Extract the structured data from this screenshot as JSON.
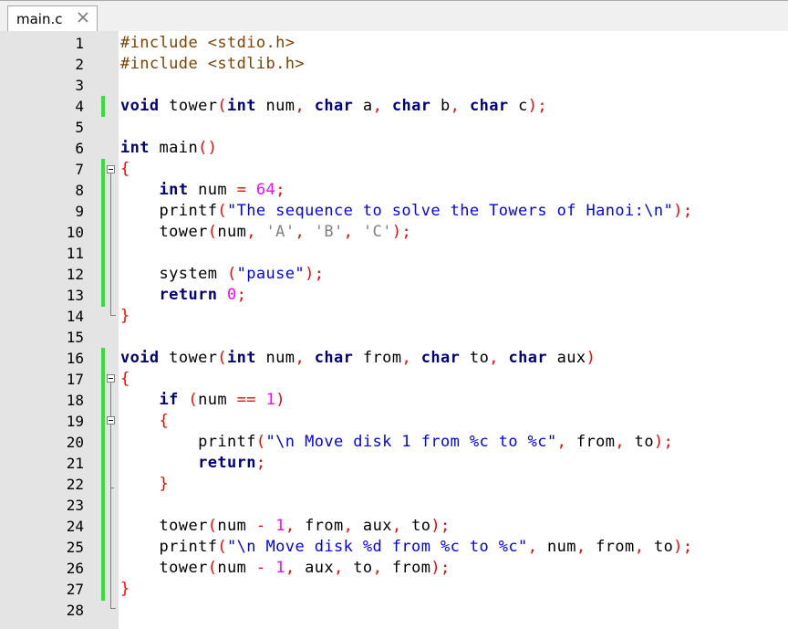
{
  "tab": {
    "filename": "main.c",
    "close_icon": "close-icon"
  },
  "colors": {
    "keyword": "#000080",
    "preprocessor": "#804000",
    "string_double": "#0000ff",
    "char_literal": "#808080",
    "number": "#ff00ff",
    "operator": "#ff0000",
    "changed_marker": "#2ee62e",
    "gutter_bg": "#e4e4e4"
  },
  "lines": [
    {
      "n": "1",
      "tokens": [
        {
          "t": "pp",
          "v": "#include <stdio.h>"
        }
      ]
    },
    {
      "n": "2",
      "tokens": [
        {
          "t": "pp",
          "v": "#include <stdlib.h>"
        }
      ]
    },
    {
      "n": "3",
      "tokens": []
    },
    {
      "n": "4",
      "tokens": [
        {
          "t": "kw",
          "v": "void"
        },
        {
          "t": "",
          "v": " tower"
        },
        {
          "t": "op",
          "v": "("
        },
        {
          "t": "kw",
          "v": "int"
        },
        {
          "t": "",
          "v": " num"
        },
        {
          "t": "op",
          "v": ","
        },
        {
          "t": "",
          "v": " "
        },
        {
          "t": "kw",
          "v": "char"
        },
        {
          "t": "",
          "v": " a"
        },
        {
          "t": "op",
          "v": ","
        },
        {
          "t": "",
          "v": " "
        },
        {
          "t": "kw",
          "v": "char"
        },
        {
          "t": "",
          "v": " b"
        },
        {
          "t": "op",
          "v": ","
        },
        {
          "t": "",
          "v": " "
        },
        {
          "t": "kw",
          "v": "char"
        },
        {
          "t": "",
          "v": " c"
        },
        {
          "t": "op",
          "v": ");"
        }
      ]
    },
    {
      "n": "5",
      "tokens": []
    },
    {
      "n": "6",
      "tokens": [
        {
          "t": "kw",
          "v": "int"
        },
        {
          "t": "",
          "v": " main"
        },
        {
          "t": "op",
          "v": "()"
        }
      ]
    },
    {
      "n": "7",
      "tokens": [
        {
          "t": "op",
          "v": "{"
        }
      ]
    },
    {
      "n": "8",
      "tokens": [
        {
          "t": "",
          "v": "    "
        },
        {
          "t": "kw",
          "v": "int"
        },
        {
          "t": "",
          "v": " num "
        },
        {
          "t": "op",
          "v": "="
        },
        {
          "t": "",
          "v": " "
        },
        {
          "t": "num",
          "v": "64"
        },
        {
          "t": "op",
          "v": ";"
        }
      ]
    },
    {
      "n": "9",
      "tokens": [
        {
          "t": "",
          "v": "    printf"
        },
        {
          "t": "op",
          "v": "("
        },
        {
          "t": "dq",
          "v": "\"The sequence to solve the Towers of Hanoi:\\n\""
        },
        {
          "t": "op",
          "v": ");"
        }
      ]
    },
    {
      "n": "10",
      "tokens": [
        {
          "t": "",
          "v": "    tower"
        },
        {
          "t": "op",
          "v": "("
        },
        {
          "t": "",
          "v": "num"
        },
        {
          "t": "op",
          "v": ","
        },
        {
          "t": "",
          "v": " "
        },
        {
          "t": "str",
          "v": "'A'"
        },
        {
          "t": "op",
          "v": ","
        },
        {
          "t": "",
          "v": " "
        },
        {
          "t": "str",
          "v": "'B'"
        },
        {
          "t": "op",
          "v": ","
        },
        {
          "t": "",
          "v": " "
        },
        {
          "t": "str",
          "v": "'C'"
        },
        {
          "t": "op",
          "v": ");"
        }
      ]
    },
    {
      "n": "11",
      "tokens": []
    },
    {
      "n": "12",
      "tokens": [
        {
          "t": "",
          "v": "    system "
        },
        {
          "t": "op",
          "v": "("
        },
        {
          "t": "dq",
          "v": "\"pause\""
        },
        {
          "t": "op",
          "v": ");"
        }
      ]
    },
    {
      "n": "13",
      "tokens": [
        {
          "t": "",
          "v": "    "
        },
        {
          "t": "kw",
          "v": "return"
        },
        {
          "t": "",
          "v": " "
        },
        {
          "t": "num",
          "v": "0"
        },
        {
          "t": "op",
          "v": ";"
        }
      ]
    },
    {
      "n": "14",
      "tokens": [
        {
          "t": "op",
          "v": "}"
        }
      ]
    },
    {
      "n": "15",
      "tokens": []
    },
    {
      "n": "16",
      "tokens": [
        {
          "t": "kw",
          "v": "void"
        },
        {
          "t": "",
          "v": " tower"
        },
        {
          "t": "op",
          "v": "("
        },
        {
          "t": "kw",
          "v": "int"
        },
        {
          "t": "",
          "v": " num"
        },
        {
          "t": "op",
          "v": ","
        },
        {
          "t": "",
          "v": " "
        },
        {
          "t": "kw",
          "v": "char"
        },
        {
          "t": "",
          "v": " from"
        },
        {
          "t": "op",
          "v": ","
        },
        {
          "t": "",
          "v": " "
        },
        {
          "t": "kw",
          "v": "char"
        },
        {
          "t": "",
          "v": " to"
        },
        {
          "t": "op",
          "v": ","
        },
        {
          "t": "",
          "v": " "
        },
        {
          "t": "kw",
          "v": "char"
        },
        {
          "t": "",
          "v": " aux"
        },
        {
          "t": "op",
          "v": ")"
        }
      ]
    },
    {
      "n": "17",
      "tokens": [
        {
          "t": "op",
          "v": "{"
        }
      ]
    },
    {
      "n": "18",
      "tokens": [
        {
          "t": "",
          "v": "    "
        },
        {
          "t": "kw",
          "v": "if"
        },
        {
          "t": "",
          "v": " "
        },
        {
          "t": "op",
          "v": "("
        },
        {
          "t": "",
          "v": "num "
        },
        {
          "t": "op",
          "v": "=="
        },
        {
          "t": "",
          "v": " "
        },
        {
          "t": "num",
          "v": "1"
        },
        {
          "t": "op",
          "v": ")"
        }
      ]
    },
    {
      "n": "19",
      "tokens": [
        {
          "t": "",
          "v": "    "
        },
        {
          "t": "op",
          "v": "{"
        }
      ]
    },
    {
      "n": "20",
      "tokens": [
        {
          "t": "",
          "v": "        printf"
        },
        {
          "t": "op",
          "v": "("
        },
        {
          "t": "dq",
          "v": "\"\\n Move disk 1 from %c to %c\""
        },
        {
          "t": "op",
          "v": ","
        },
        {
          "t": "",
          "v": " from"
        },
        {
          "t": "op",
          "v": ","
        },
        {
          "t": "",
          "v": " to"
        },
        {
          "t": "op",
          "v": ");"
        }
      ]
    },
    {
      "n": "21",
      "tokens": [
        {
          "t": "",
          "v": "        "
        },
        {
          "t": "kw",
          "v": "return"
        },
        {
          "t": "op",
          "v": ";"
        }
      ]
    },
    {
      "n": "22",
      "tokens": [
        {
          "t": "",
          "v": "    "
        },
        {
          "t": "op",
          "v": "}"
        }
      ]
    },
    {
      "n": "23",
      "tokens": []
    },
    {
      "n": "24",
      "tokens": [
        {
          "t": "",
          "v": "    tower"
        },
        {
          "t": "op",
          "v": "("
        },
        {
          "t": "",
          "v": "num "
        },
        {
          "t": "op",
          "v": "-"
        },
        {
          "t": "",
          "v": " "
        },
        {
          "t": "num",
          "v": "1"
        },
        {
          "t": "op",
          "v": ","
        },
        {
          "t": "",
          "v": " from"
        },
        {
          "t": "op",
          "v": ","
        },
        {
          "t": "",
          "v": " aux"
        },
        {
          "t": "op",
          "v": ","
        },
        {
          "t": "",
          "v": " to"
        },
        {
          "t": "op",
          "v": ");"
        }
      ]
    },
    {
      "n": "25",
      "tokens": [
        {
          "t": "",
          "v": "    printf"
        },
        {
          "t": "op",
          "v": "("
        },
        {
          "t": "dq",
          "v": "\"\\n Move disk %d from %c to %c\""
        },
        {
          "t": "op",
          "v": ","
        },
        {
          "t": "",
          "v": " num"
        },
        {
          "t": "op",
          "v": ","
        },
        {
          "t": "",
          "v": " from"
        },
        {
          "t": "op",
          "v": ","
        },
        {
          "t": "",
          "v": " to"
        },
        {
          "t": "op",
          "v": ");"
        }
      ]
    },
    {
      "n": "26",
      "tokens": [
        {
          "t": "",
          "v": "    tower"
        },
        {
          "t": "op",
          "v": "("
        },
        {
          "t": "",
          "v": "num "
        },
        {
          "t": "op",
          "v": "-"
        },
        {
          "t": "",
          "v": " "
        },
        {
          "t": "num",
          "v": "1"
        },
        {
          "t": "op",
          "v": ","
        },
        {
          "t": "",
          "v": " aux"
        },
        {
          "t": "op",
          "v": ","
        },
        {
          "t": "",
          "v": " to"
        },
        {
          "t": "op",
          "v": ","
        },
        {
          "t": "",
          "v": " from"
        },
        {
          "t": "op",
          "v": ");"
        }
      ]
    },
    {
      "n": "27",
      "tokens": [
        {
          "t": "op",
          "v": "}"
        }
      ]
    },
    {
      "n": "28",
      "tokens": []
    }
  ]
}
